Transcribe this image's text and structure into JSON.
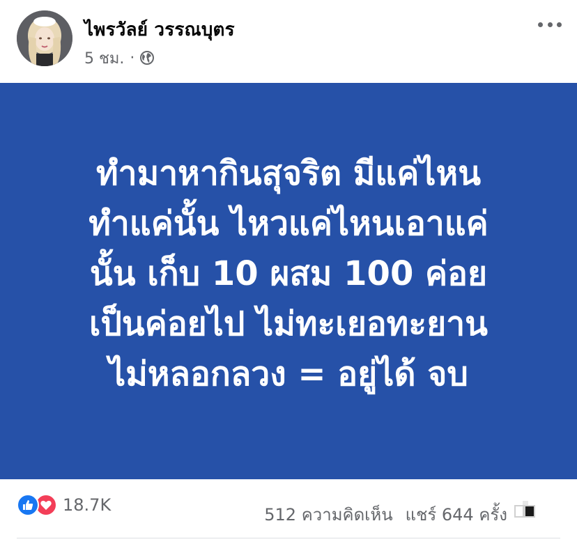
{
  "post": {
    "author_name": "ไพรวัลย์ วรรณบุตร",
    "time": "5 ชม.",
    "separator": "·",
    "audience_icon": "globe-icon",
    "more_icon": "more-horizontal-icon",
    "image_text_lines": [
      "ทำมาหากินสุจริต มีแค่ไหน",
      "ทำแค่นั้น ไหวแค่ไหนเอาแค่",
      "นั้น เก็บ 10 ผสม 100 ค่อย",
      "เป็นค่อยไป ไม่ทะเยอทะยาน",
      "ไม่หลอกลวง = อยู่ได้ จบ"
    ]
  },
  "engagement": {
    "reaction_icons": [
      "like-icon",
      "love-icon"
    ],
    "reaction_count": "18.7K",
    "comments": "512 ความคิดเห็น",
    "shares": "แชร์ 644 ครั้ง"
  },
  "colors": {
    "image_background": "#2651a8",
    "image_text": "#ffffff",
    "like": "#1877f2",
    "love": "#f33e58",
    "secondary_text": "#65676b"
  }
}
